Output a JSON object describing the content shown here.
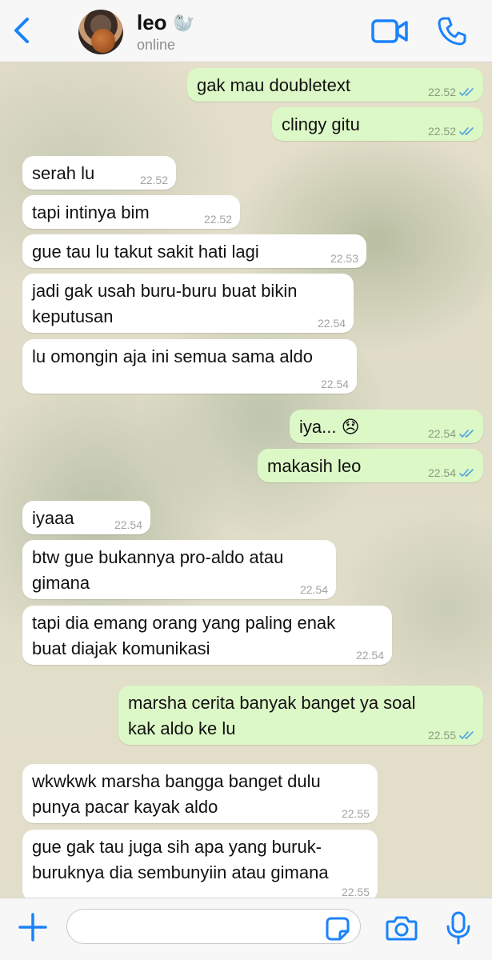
{
  "header": {
    "contact_name": "leo",
    "contact_emoji": "🦭",
    "status": "online",
    "icons": [
      "back-chevron-icon",
      "video-call-icon",
      "phone-call-icon"
    ],
    "accent_color": "#1a82fb"
  },
  "messages": [
    {
      "dir": "out",
      "text": "gak mau doubletext",
      "time": "22.52",
      "read": true
    },
    {
      "dir": "out",
      "text": "clingy gitu",
      "time": "22.52",
      "read": true
    },
    {
      "dir": "in",
      "text": "serah lu",
      "time": "22.52"
    },
    {
      "dir": "in",
      "text": "tapi intinya bim",
      "time": "22.52"
    },
    {
      "dir": "in",
      "text": "gue tau lu takut sakit hati lagi",
      "time": "22.53"
    },
    {
      "dir": "in",
      "text": "jadi gak usah buru-buru buat bikin\nkeputusan",
      "time": "22.54"
    },
    {
      "dir": "in",
      "text": "lu omongin aja ini semua sama aldo",
      "time": "22.54"
    },
    {
      "dir": "out",
      "text": "iya... 😞",
      "time": "22.54",
      "read": true
    },
    {
      "dir": "out",
      "text": "makasih leo",
      "time": "22.54",
      "read": true
    },
    {
      "dir": "in",
      "text": "iyaaa",
      "time": "22.54"
    },
    {
      "dir": "in",
      "text": "btw gue bukannya pro-aldo atau\ngimana",
      "time": "22.54"
    },
    {
      "dir": "in",
      "text": "tapi dia emang orang yang paling enak\nbuat diajak komunikasi",
      "time": "22.54"
    },
    {
      "dir": "out",
      "text": "marsha cerita banyak banget ya soal\nkak aldo ke lu",
      "time": "22.55",
      "read": true
    },
    {
      "dir": "in",
      "text": "wkwkwk marsha bangga banget dulu\npunya pacar kayak aldo",
      "time": "22.55"
    },
    {
      "dir": "in",
      "text": "gue gak tau juga sih apa yang buruk-\nburuknya dia sembunyiin atau gimana",
      "time": "22.55"
    }
  ],
  "composer": {
    "input_value": "",
    "icons": [
      "plus-icon",
      "sticker-icon",
      "camera-icon",
      "microphone-icon"
    ]
  },
  "colors": {
    "outgoing_bubble": "#dcf8c6",
    "incoming_bubble": "#ffffff",
    "read_ticks": "#4fa3e0"
  }
}
